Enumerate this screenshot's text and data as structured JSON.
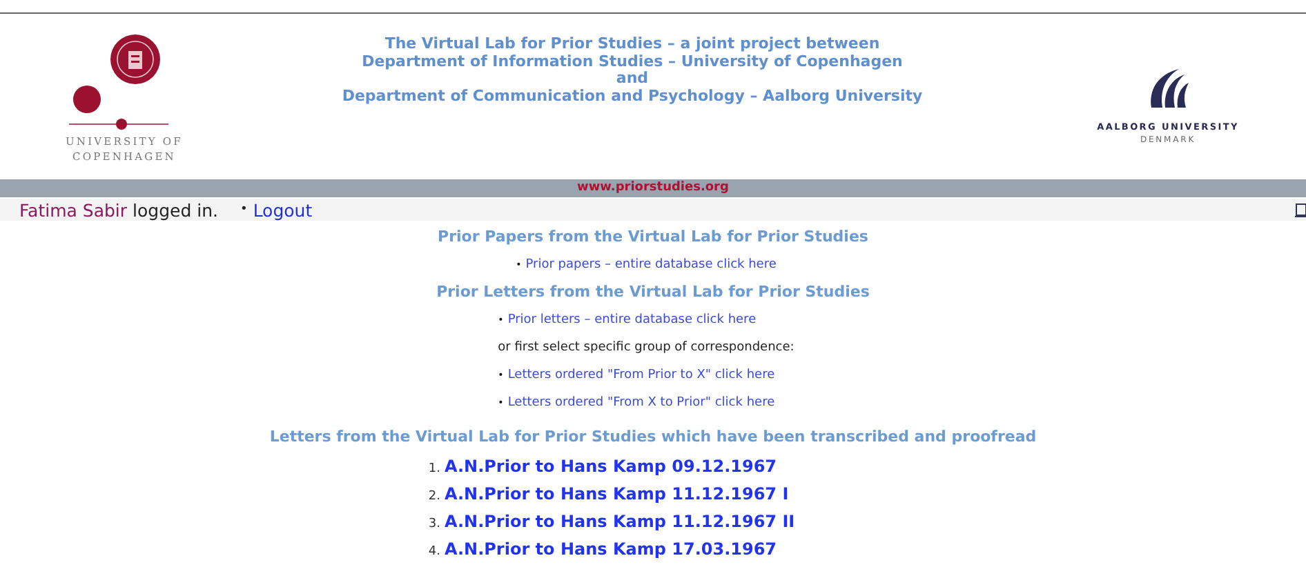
{
  "header": {
    "left_logo": {
      "lines": [
        "UNIVERSITY OF",
        "COPENHAGEN"
      ]
    },
    "title_lines": [
      "The Virtual Lab for Prior Studies – a joint project between",
      "Department of Information  Studies – University of Copenhagen",
      "and",
      "Department of Communication and Psychology – Aalborg University"
    ],
    "right_logo": {
      "name": "AALBORG UNIVERSITY",
      "country": "DENMARK"
    }
  },
  "url_bar": "www.priorstudies.org",
  "login": {
    "user": "Fatima Sabir",
    "status": "logged in.",
    "bullet": "•",
    "link": "Logout"
  },
  "sections": [
    {
      "heading": "Prior Papers from the Virtual Lab for Prior Studies",
      "items": [
        {
          "kind": "link",
          "bullet": "•",
          "text": "Prior papers – entire database click here"
        }
      ]
    },
    {
      "heading": "Prior Letters from the Virtual Lab for Prior Studies",
      "items": [
        {
          "kind": "link",
          "bullet": "•",
          "text": "Prior letters – entire database click here"
        },
        {
          "kind": "note",
          "text": "or first select specific group of correspondence:"
        },
        {
          "kind": "link",
          "bullet": "•",
          "text": "Letters ordered \"From Prior to X\"  click here"
        },
        {
          "kind": "link",
          "bullet": "•",
          "text": "Letters ordered \"From X to Prior\"  click here"
        }
      ]
    }
  ],
  "transcribed": {
    "heading": "Letters from the Virtual Lab for Prior Studies which have been transcribed and proofread",
    "letters": [
      {
        "number": "1.",
        "title": "A.N.Prior to Hans Kamp 09.12.1967"
      },
      {
        "number": "2.",
        "title": "A.N.Prior to Hans Kamp 11.12.1967 I"
      },
      {
        "number": "3.",
        "title": "A.N.Prior to Hans Kamp 11.12.1967 II"
      },
      {
        "number": "4.",
        "title": "A.N.Prior to Hans Kamp 17.03.1967"
      }
    ]
  }
}
